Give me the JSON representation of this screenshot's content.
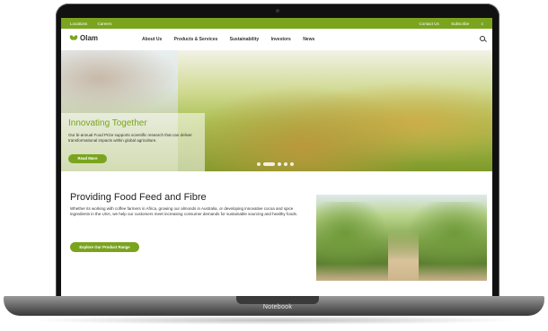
{
  "device": {
    "label": "Notebook"
  },
  "utility_bar": {
    "left_links": [
      "Locations",
      "Careers"
    ],
    "right_links": [
      "Contact Us",
      "Subscribe"
    ],
    "menu_icon": "menu-icon"
  },
  "header": {
    "logo_text": "Olam",
    "nav": [
      "About Us",
      "Products & Services",
      "Sustainability",
      "Investors",
      "News"
    ],
    "search_icon": "search-icon"
  },
  "hero": {
    "title": "Innovating Together",
    "text": "Our bi-annual Food Prize supports scientific research that can deliver transformational impacts within global agriculture.",
    "button": "Read More",
    "slides": 5,
    "active_slide": 2
  },
  "content": {
    "title": "Providing Food Feed and Fibre",
    "text": "Whether its working with coffee farmers in Africa, growing our almonds in Australia, or developing innovative cocoa and spice ingredients in the USA, we help our customers meet increasing consumer demands for sustainable sourcing and healthy foods.",
    "cta": "Explore Our Product Range"
  },
  "colors": {
    "accent": "#7aa41e"
  }
}
